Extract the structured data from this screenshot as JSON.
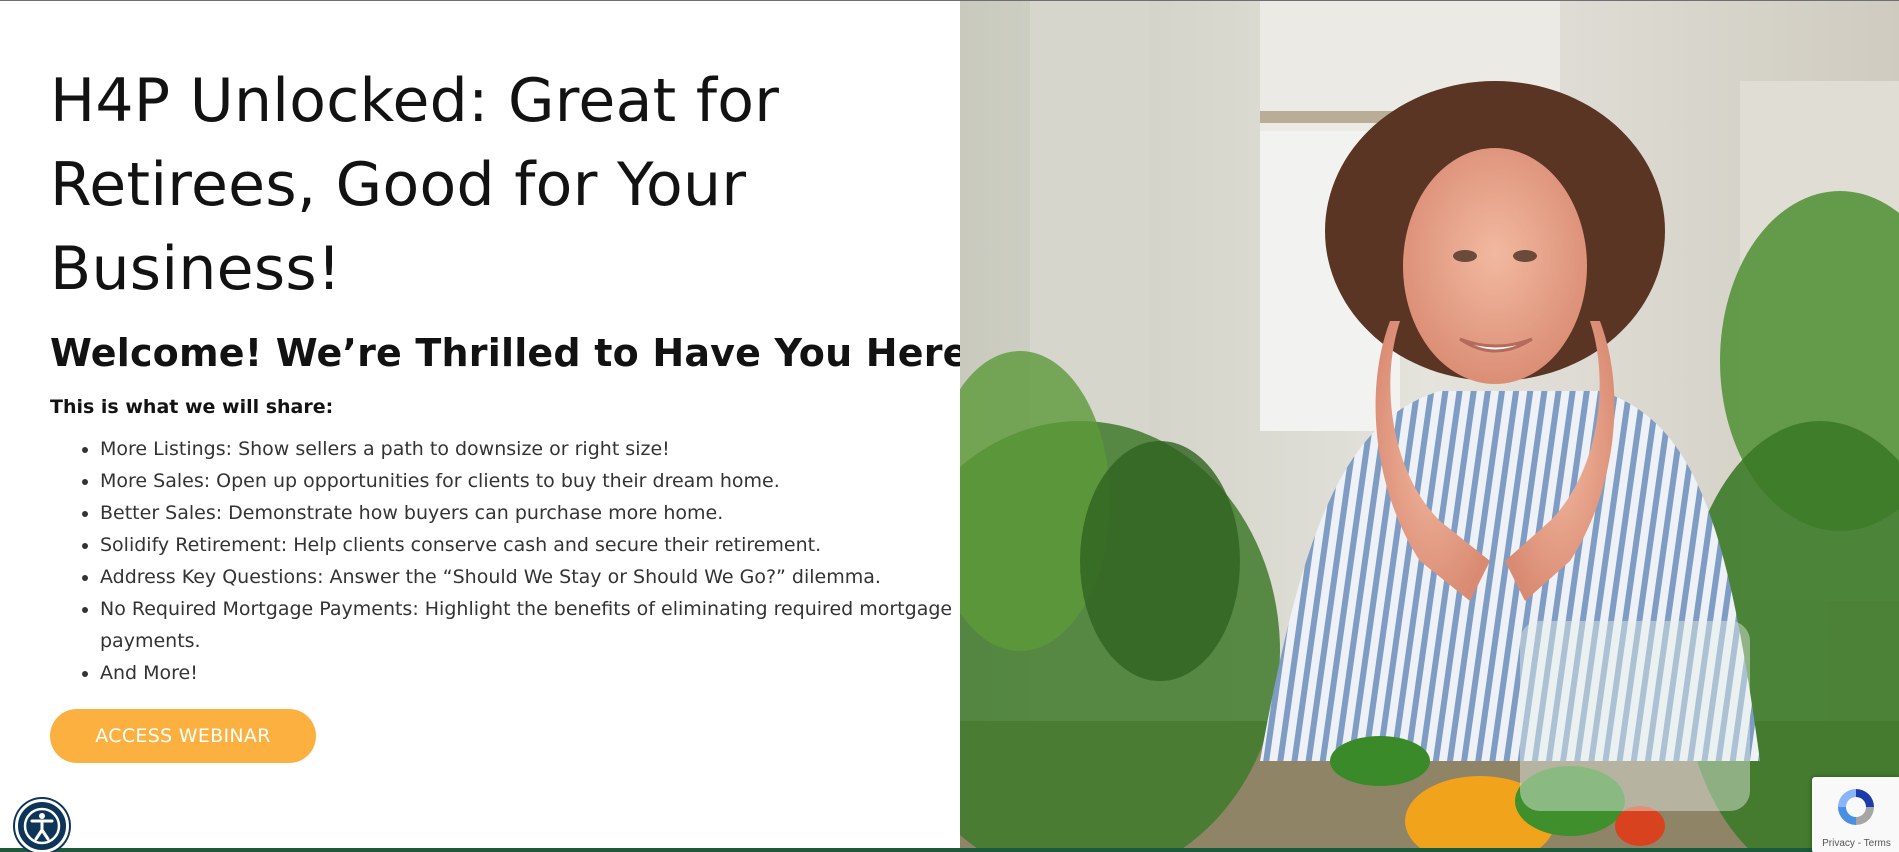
{
  "hero": {
    "title": "H4P Unlocked: Great for Retirees, Good for Your Business!",
    "subtitle": "Welcome! We’re Thrilled to Have You Here!",
    "intro": "This is what we will share:",
    "bullets": [
      "More Listings: Show sellers a path to downsize or right size!",
      "More Sales: Open up opportunities for clients to buy their dream home.",
      "Better Sales: Demonstrate how buyers can purchase more home.",
      "Solidify Retirement: Help clients conserve cash and secure their retirement.",
      "Address Key Questions: Answer the “Should We Stay or Should We Go?” dilemma.",
      "No Required Mortgage Payments: Highlight the benefits of eliminating required mortgage payments.",
      "And More!"
    ],
    "cta_label": "ACCESS WEBINAR"
  },
  "photo": {
    "description_icon": "smiling-retiree-photo"
  },
  "accessibility": {
    "icon": "accessibility-person-icon"
  },
  "recaptcha": {
    "privacy": "Privacy",
    "separator": " - ",
    "terms": "Terms"
  },
  "colors": {
    "cta": "#fbb040",
    "title": "#121212",
    "body": "#333333",
    "a11y": "#0e3558",
    "bottom_bar": "#1d5a3c"
  }
}
